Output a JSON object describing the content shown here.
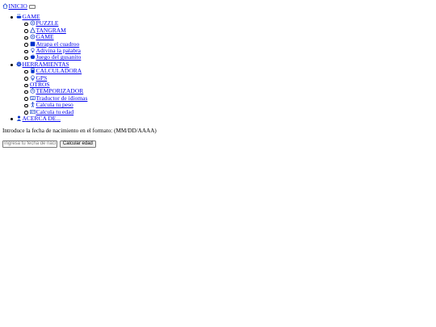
{
  "nav": {
    "home": {
      "label": "INICIO",
      "icon": "home-icon"
    },
    "menu_toggle_icon": "hamburger-icon",
    "sections": [
      {
        "label": "GAME",
        "icon": "gamepad-icon",
        "items": [
          {
            "label": "PUZZLE",
            "icon": "puzzle-icon"
          },
          {
            "label": "TANGRAM",
            "icon": "triangle-icon"
          },
          {
            "label": "GAME",
            "icon": "controller-icon"
          },
          {
            "label": "Atrapa el cuadroo",
            "icon": "square-icon"
          },
          {
            "label": "Adivina la palabra",
            "icon": "lightbulb-icon"
          },
          {
            "label": "Juego del gusanito",
            "icon": "apple-icon"
          }
        ]
      },
      {
        "label": "HERRAMIENTAS",
        "icon": "gear-icon",
        "items": [
          {
            "label": "CALCULADORA",
            "icon": "calculator-icon"
          },
          {
            "label": "GPS",
            "icon": "location-icon"
          },
          {
            "label": "OTROS",
            "icon": ""
          },
          {
            "label": "TEMPORIZADOR",
            "icon": "clock-icon"
          },
          {
            "label": "Traductor de idiomas",
            "icon": "keyboard-icon"
          },
          {
            "label": "Calcula tu peso",
            "icon": "person-icon"
          },
          {
            "label": "Calcula tu edad",
            "icon": "id-card-icon"
          }
        ]
      },
      {
        "label": "ACERCA DE...",
        "icon": "user-icon",
        "items": []
      }
    ]
  },
  "main": {
    "instruction": "Introduce la fecha de nacimiento en el formato: (MM/DD/AAAA)",
    "date_input": {
      "placeholder": "Ingresa tu fecha de nacimiento",
      "value": ""
    },
    "submit_label": "Calcular edad"
  },
  "colors": {
    "link": "#0000ee",
    "icon": "#0033cc",
    "text": "#000000"
  }
}
